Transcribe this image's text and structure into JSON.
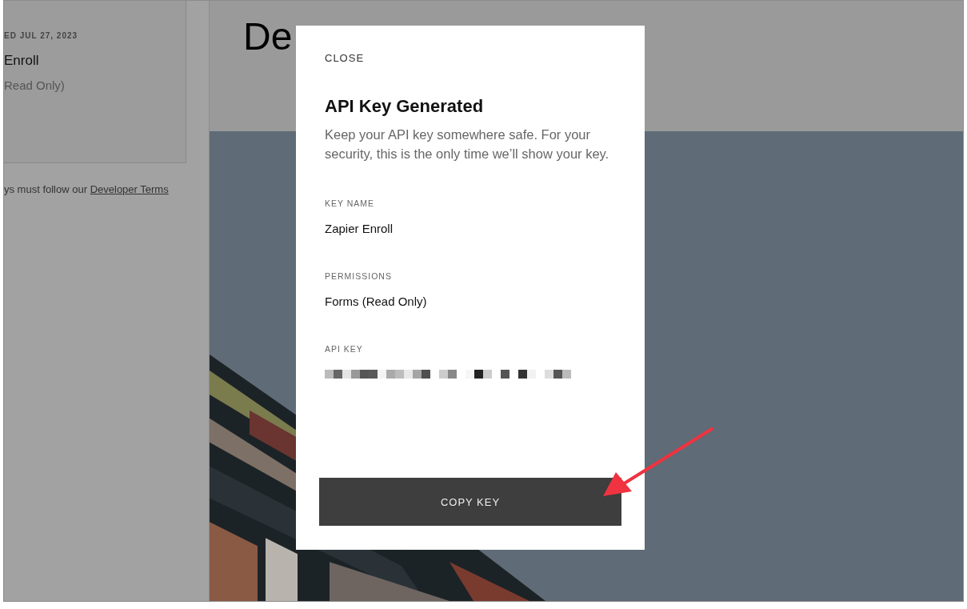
{
  "background": {
    "card": {
      "date": "ED JUL 27, 2023",
      "name": "Enroll",
      "permissions": "Read Only)"
    },
    "terms_note": {
      "text": "ys must follow our ",
      "link": "Developer Terms"
    },
    "heading": "De"
  },
  "modal": {
    "close": "CLOSE",
    "title": "API Key Generated",
    "description": "Keep your API key somewhere safe. For your security, this is the only time we’ll show your key.",
    "fields": [
      {
        "kind": "text",
        "label": "KEY NAME",
        "value": "Zapier Enroll"
      },
      {
        "kind": "text",
        "label": "PERMISSIONS",
        "value": "Forms (Read Only)"
      },
      {
        "kind": "redacted",
        "label": "API KEY"
      }
    ],
    "button": "COPY KEY"
  }
}
